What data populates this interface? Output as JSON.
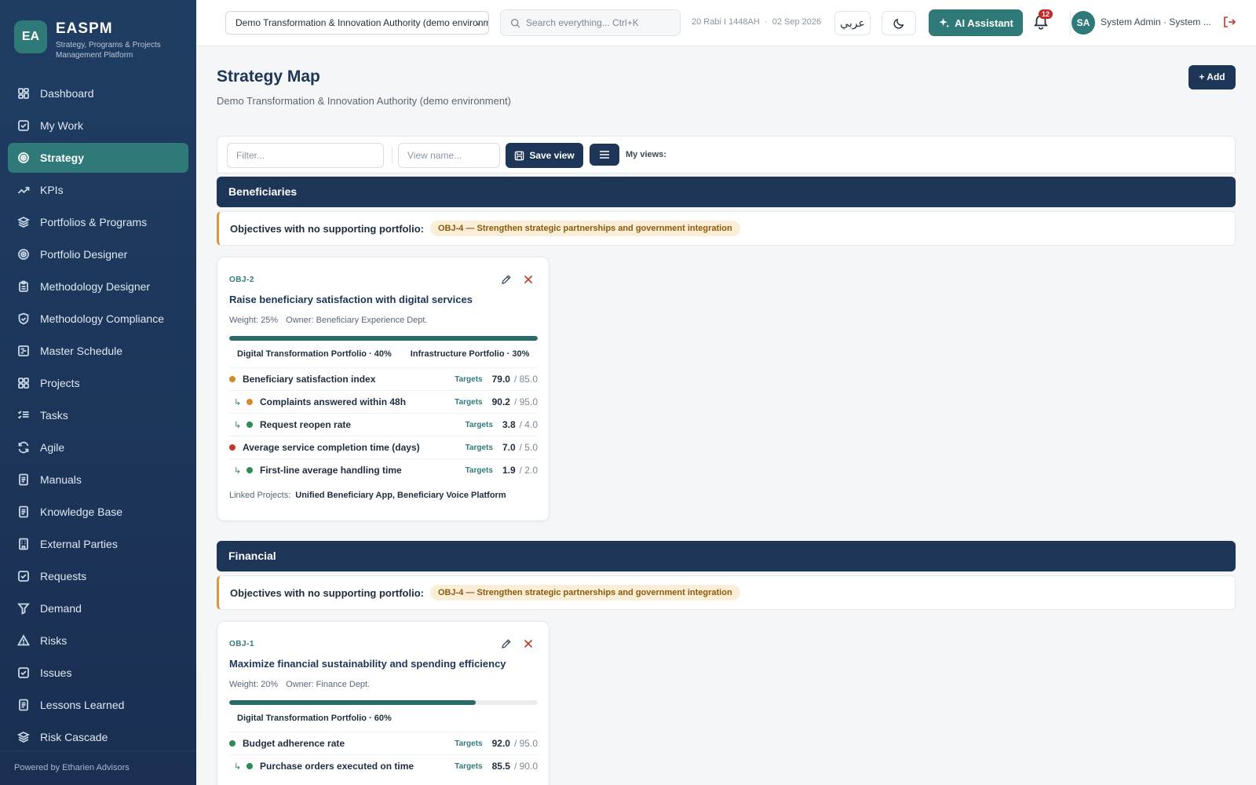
{
  "brand": {
    "logo": "EA",
    "title": "EASPM",
    "subtitle": "Strategy, Programs & Projects Management Platform"
  },
  "sidebar": {
    "items": [
      {
        "label": "Dashboard",
        "icon": "dashboard-icon"
      },
      {
        "label": "My Work",
        "icon": "check-square-icon"
      },
      {
        "label": "Strategy",
        "icon": "target-icon",
        "active": true
      },
      {
        "label": "KPIs",
        "icon": "trend-icon"
      },
      {
        "label": "Portfolios & Programs",
        "icon": "layers-icon"
      },
      {
        "label": "Portfolio Designer",
        "icon": "target-icon"
      },
      {
        "label": "Methodology Designer",
        "icon": "clipboard-icon"
      },
      {
        "label": "Methodology Compliance",
        "icon": "shield-icon"
      },
      {
        "label": "Master Schedule",
        "icon": "gantt-icon"
      },
      {
        "label": "Projects",
        "icon": "grid-icon"
      },
      {
        "label": "Tasks",
        "icon": "list-check-icon"
      },
      {
        "label": "Agile",
        "icon": "refresh-icon"
      },
      {
        "label": "Manuals",
        "icon": "document-icon"
      },
      {
        "label": "Knowledge Base",
        "icon": "document-icon"
      },
      {
        "label": "External Parties",
        "icon": "building-icon"
      },
      {
        "label": "Requests",
        "icon": "check-square-icon"
      },
      {
        "label": "Demand",
        "icon": "funnel-icon"
      },
      {
        "label": "Risks",
        "icon": "warning-icon"
      },
      {
        "label": "Issues",
        "icon": "check-square-icon"
      },
      {
        "label": "Lessons Learned",
        "icon": "document-icon"
      },
      {
        "label": "Risk Cascade",
        "icon": "layers-icon"
      }
    ],
    "footer": "Powered by Etharien Advisors"
  },
  "topbar": {
    "org_select": "Demo Transformation & Innovation Authority (demo environment)",
    "search_placeholder": "Search everything...  Ctrl+K",
    "hijri_date": "20 Rabi I 1448AH",
    "date": "02 Sep 2026",
    "lang_button": "عربي",
    "ai_button": "AI Assistant",
    "notifications_count": "12",
    "avatar": "SA",
    "user_name": "System Admin · System ..."
  },
  "page": {
    "title": "Strategy Map",
    "subtitle": "Demo Transformation & Innovation Authority (demo environment)",
    "add_button": "+ Add"
  },
  "filter_bar": {
    "filter_placeholder": "Filter...",
    "view_name_placeholder": "View name...",
    "save_view": "Save view",
    "my_views": "My views:"
  },
  "sections": [
    {
      "title": "Beneficiaries",
      "warning_label": "Objectives with no supporting portfolio:",
      "warning_chip": "OBJ-4 — Strengthen strategic partnerships and government integration",
      "card": {
        "code": "OBJ-2",
        "title": "Raise beneficiary satisfaction with digital services",
        "weight": "Weight: 25%",
        "owner": "Owner: Beneficiary Experience Dept.",
        "progress": 1.0,
        "portfolios": [
          "Digital Transformation Portfolio · 40%",
          "Infrastructure Portfolio · 30%"
        ],
        "kpis": [
          {
            "name": "Beneficiary satisfaction index",
            "status": "#d08a2a",
            "child": false,
            "targets": "Targets",
            "actual": "79.0",
            "target": "/ 85.0"
          },
          {
            "name": "Complaints answered within 48h",
            "status": "#d08a2a",
            "child": true,
            "targets": "Targets",
            "actual": "90.2",
            "target": "/ 95.0"
          },
          {
            "name": "Request reopen rate",
            "status": "#2e8b57",
            "child": true,
            "targets": "Targets",
            "actual": "3.8",
            "target": "/ 4.0"
          },
          {
            "name": "Average service completion time (days)",
            "status": "#c0392b",
            "child": false,
            "targets": "Targets",
            "actual": "7.0",
            "target": "/ 5.0"
          },
          {
            "name": "First-line average handling time",
            "status": "#2e8b57",
            "child": true,
            "targets": "Targets",
            "actual": "1.9",
            "target": "/ 2.0"
          }
        ],
        "linked_label": "Linked Projects:",
        "linked_projects": "Unified Beneficiary App, Beneficiary Voice Platform"
      }
    },
    {
      "title": "Financial",
      "warning_label": "Objectives with no supporting portfolio:",
      "warning_chip": "OBJ-4 — Strengthen strategic partnerships and government integration",
      "card": {
        "code": "OBJ-1",
        "title": "Maximize financial sustainability and spending efficiency",
        "weight": "Weight: 20%",
        "owner": "Owner: Finance Dept.",
        "progress": 0.8,
        "portfolios": [
          "Digital Transformation Portfolio · 60%"
        ],
        "kpis": [
          {
            "name": "Budget adherence rate",
            "status": "#2e8b57",
            "child": false,
            "targets": "Targets",
            "actual": "92.0",
            "target": "/ 95.0"
          },
          {
            "name": "Purchase orders executed on time",
            "status": "#2e8b57",
            "child": true,
            "targets": "Targets",
            "actual": "85.5",
            "target": "/ 90.0"
          }
        ]
      }
    }
  ],
  "colors": {
    "sidebar": "#1f3d63",
    "accent": "#2f7a78",
    "navy": "#1d3557",
    "warning": "#d9963a"
  }
}
